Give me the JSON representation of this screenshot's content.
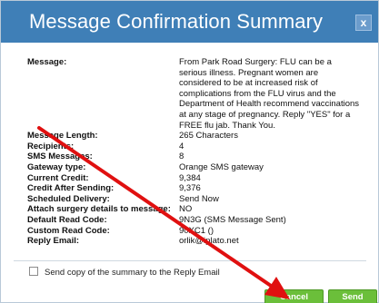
{
  "dialog": {
    "title": "Message Confirmation Summary",
    "close_label": "x",
    "accent_color": "#3f7fb7"
  },
  "summary": [
    {
      "label": "Message:",
      "value": "From Park Road Surgery: FLU can be a serious illness. Pregnant women are considered to be at increased risk of complications from the FLU virus and the Department of Health recommend vaccinations at any stage of pregnancy. Reply \"YES\" for a FREE flu jab. Thank You."
    },
    {
      "label": "Message Length:",
      "value": "265 Characters"
    },
    {
      "label": "Recipients:",
      "value": "4"
    },
    {
      "label": "SMS Messages:",
      "value": "8"
    },
    {
      "label": "Gateway type:",
      "value": "Orange SMS gateway"
    },
    {
      "label": "Current Credit:",
      "value": "9,384"
    },
    {
      "label": "Credit After Sending:",
      "value": "9,376"
    },
    {
      "label": "Scheduled Delivery:",
      "value": "Send Now"
    },
    {
      "label": "Attach surgery details to message:",
      "value": "NO"
    },
    {
      "label": "Default Read Code:",
      "value": "9N3G (SMS Message Sent)"
    },
    {
      "label": "Custom Read Code:",
      "value": "90XC1 ()"
    },
    {
      "label": "Reply Email:",
      "value": "orlik@iplato.net"
    }
  ],
  "options": {
    "copy_summary_label": "Send copy of the summary to the Reply Email",
    "copy_summary_checked": false
  },
  "buttons": {
    "cancel_label": "Cancel",
    "send_label": "Send",
    "button_color": "#6bbf3a"
  },
  "annotation": {
    "arrow_color": "#e01010"
  }
}
